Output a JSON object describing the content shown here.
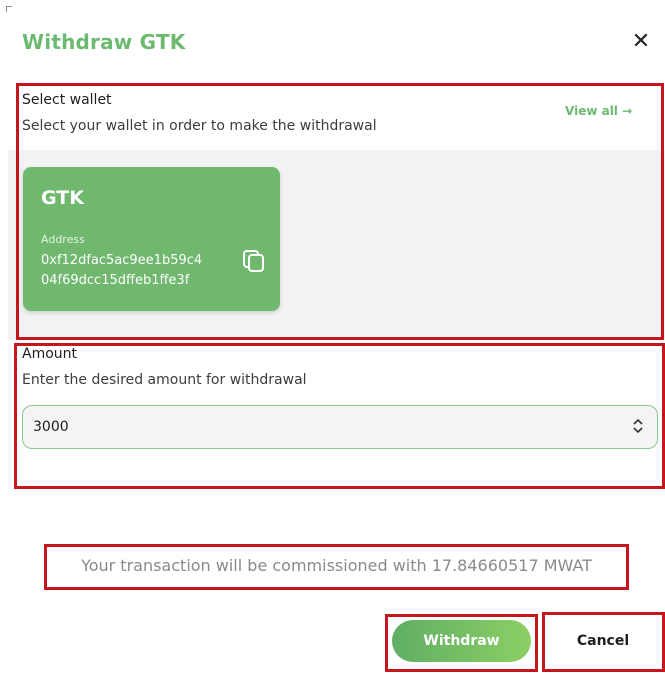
{
  "dialog": {
    "title": "Withdraw GTK",
    "close_icon": "close-icon"
  },
  "wallet_section": {
    "label": "Select wallet",
    "description": "Select your wallet in order to make the withdrawal",
    "view_all": "View all →",
    "wallets": [
      {
        "name": "GTK",
        "address_label": "Address",
        "address_line1": "0xf12dfac5ac9ee1b59c4",
        "address_line2": "04f69dcc15dffeb1ffe3f",
        "copy_icon": "copy-icon"
      }
    ]
  },
  "amount_section": {
    "label": "Amount",
    "description": "Enter the desired amount for withdrawal",
    "value": "3000",
    "spinner_icon": "spinner-icon"
  },
  "commission": {
    "text": "Your transaction will be commissioned with 17.84660517 MWAT"
  },
  "actions": {
    "withdraw_label": "Withdraw",
    "cancel_label": "Cancel"
  },
  "colors": {
    "accent": "#6cba70",
    "card": "#6fb86e",
    "highlight": "#c4161c"
  }
}
